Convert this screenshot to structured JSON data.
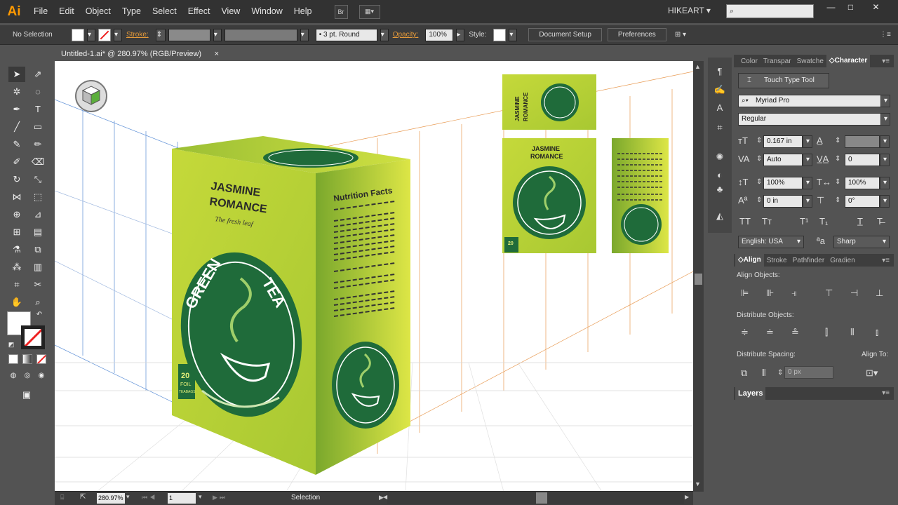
{
  "app": {
    "logo": "Ai"
  },
  "menu": [
    "File",
    "Edit",
    "Object",
    "Type",
    "Select",
    "Effect",
    "View",
    "Window",
    "Help"
  ],
  "menubar": {
    "bridge": "Br",
    "workspace": "HIKEART"
  },
  "control": {
    "selection": "No Selection",
    "stroke_label": "Stroke:",
    "brush": "3 pt. Round",
    "opacity_label": "Opacity:",
    "opacity": "100%",
    "style_label": "Style:",
    "doc_setup": "Document Setup",
    "preferences": "Preferences"
  },
  "doc": {
    "tab": "Untitled-1.ai* @ 280.97% (RGB/Preview)"
  },
  "status": {
    "zoom": "280.97%",
    "page": "1",
    "tool": "Selection"
  },
  "artwork": {
    "title1": "JASMINE",
    "title2": "ROMANCE",
    "tagline": "The fresh leaf",
    "green": "GREEN",
    "tea": "TEA",
    "count": "20",
    "foil": "FOIL",
    "teabags": "TEABAGS",
    "nutrition": "Nutrition Facts",
    "colors": {
      "box_light": "#c8dc3c",
      "box_dark": "#7dac2e",
      "badge": "#1f6b3a"
    }
  },
  "panel": {
    "tabs": [
      "Color",
      "Transpar",
      "Swatche",
      "Character"
    ],
    "touch_type": "Touch Type Tool",
    "font": "Myriad Pro",
    "style": "Regular",
    "size": "0.167 in",
    "leading": "",
    "kerning": "Auto",
    "tracking": "0",
    "vscale": "100%",
    "hscale": "100%",
    "baseline": "0 in",
    "rotation": "0°",
    "language": "English: USA",
    "aa": "Sharp",
    "align_tabs": [
      "Align",
      "Stroke",
      "Pathfinder",
      "Gradien"
    ],
    "align_objects": "Align Objects:",
    "distribute_objects": "Distribute Objects:",
    "distribute_spacing": "Distribute Spacing:",
    "align_to": "Align To:",
    "spacing": "0 px",
    "layers": "Layers"
  }
}
